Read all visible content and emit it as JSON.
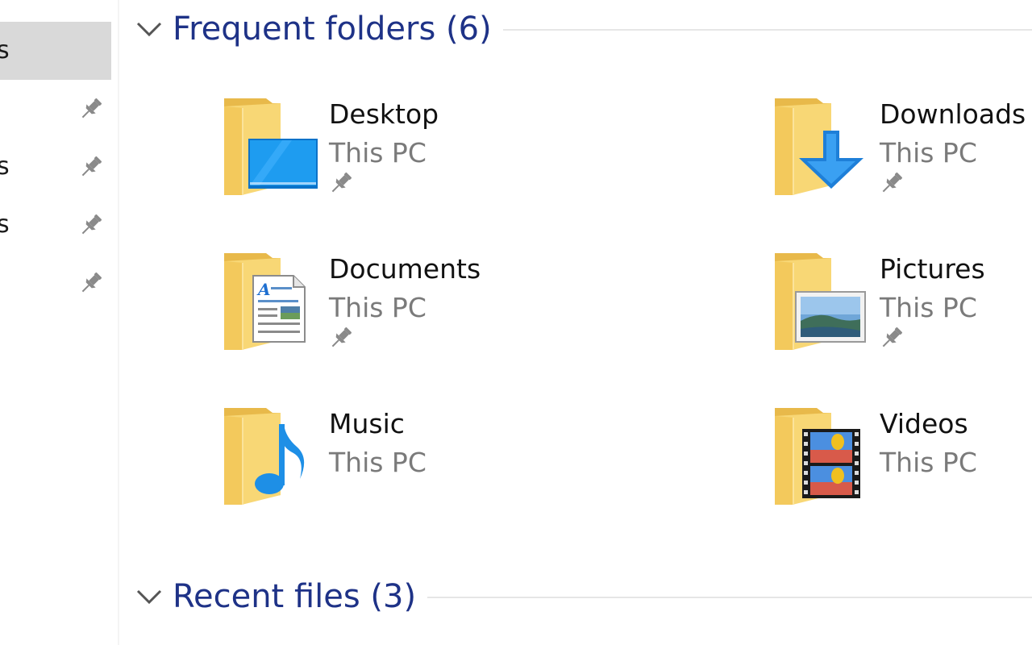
{
  "nav": {
    "items": [
      {
        "label": "s",
        "selected": true,
        "pinned": false
      },
      {
        "label": "",
        "selected": false,
        "pinned": true
      },
      {
        "label": "s",
        "selected": false,
        "pinned": true
      },
      {
        "label": "s",
        "selected": false,
        "pinned": true
      },
      {
        "label": "",
        "selected": false,
        "pinned": true
      }
    ]
  },
  "frequent": {
    "title": "Frequent folders (6)",
    "folders": [
      {
        "name": "Desktop",
        "location": "This PC",
        "pinned": true,
        "icon": "desktop-folder-icon"
      },
      {
        "name": "Downloads",
        "location": "This PC",
        "pinned": true,
        "icon": "downloads-folder-icon"
      },
      {
        "name": "Documents",
        "location": "This PC",
        "pinned": true,
        "icon": "documents-folder-icon"
      },
      {
        "name": "Pictures",
        "location": "This PC",
        "pinned": true,
        "icon": "pictures-folder-icon"
      },
      {
        "name": "Music",
        "location": "This PC",
        "pinned": false,
        "icon": "music-folder-icon"
      },
      {
        "name": "Videos",
        "location": "This PC",
        "pinned": false,
        "icon": "videos-folder-icon"
      }
    ]
  },
  "recent": {
    "title": "Recent files (3)"
  },
  "colors": {
    "section_title": "#1e3287",
    "selected_bg": "#d9d9d9",
    "folder_yellow": "#f8d775",
    "accent_blue": "#1e90e8"
  }
}
